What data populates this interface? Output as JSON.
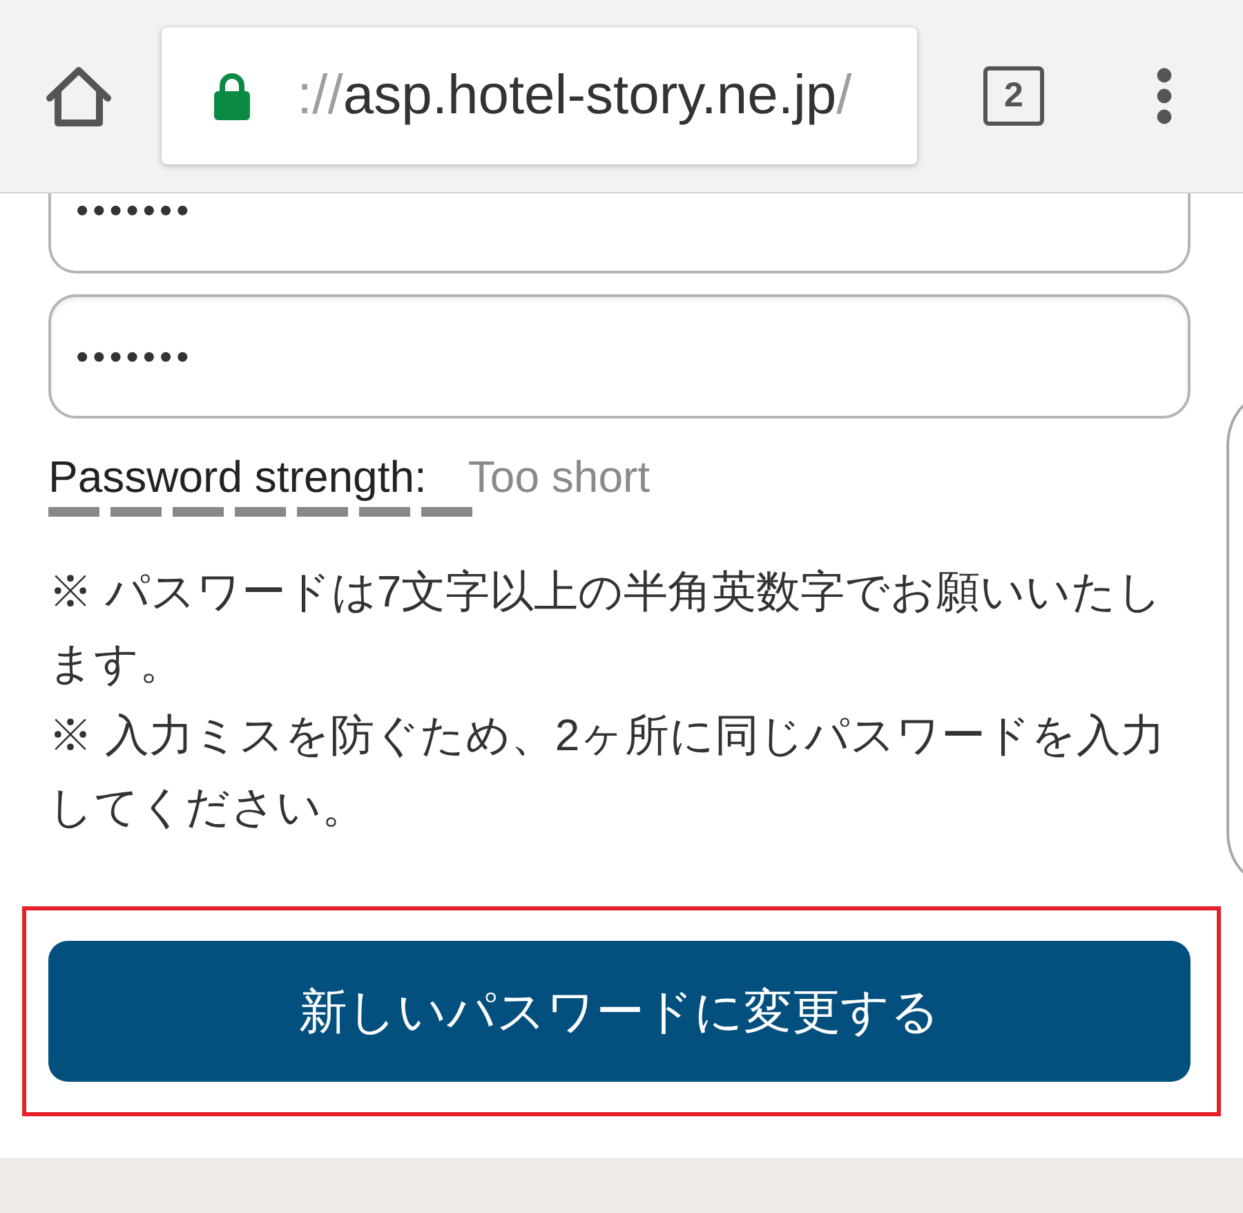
{
  "browser": {
    "secure": true,
    "url_prefix": "://",
    "url_host": "asp.hotel-story.ne.jp",
    "url_path": "/",
    "tab_count": "2"
  },
  "form": {
    "password_fields": [
      {
        "value": "•••••••"
      },
      {
        "value": "•••••••"
      }
    ],
    "password_strength": {
      "label": "Password strength:",
      "value": "Too short",
      "level": 0
    },
    "notes": [
      "※ パスワードは7文字以上の半角英数字でお願いいたします。",
      "※ 入力ミスを防ぐため、2ヶ所に同じパスワードを入力してください。"
    ],
    "submit_button": {
      "label": "新しいパスワードに変更する",
      "highlighted": true
    }
  }
}
